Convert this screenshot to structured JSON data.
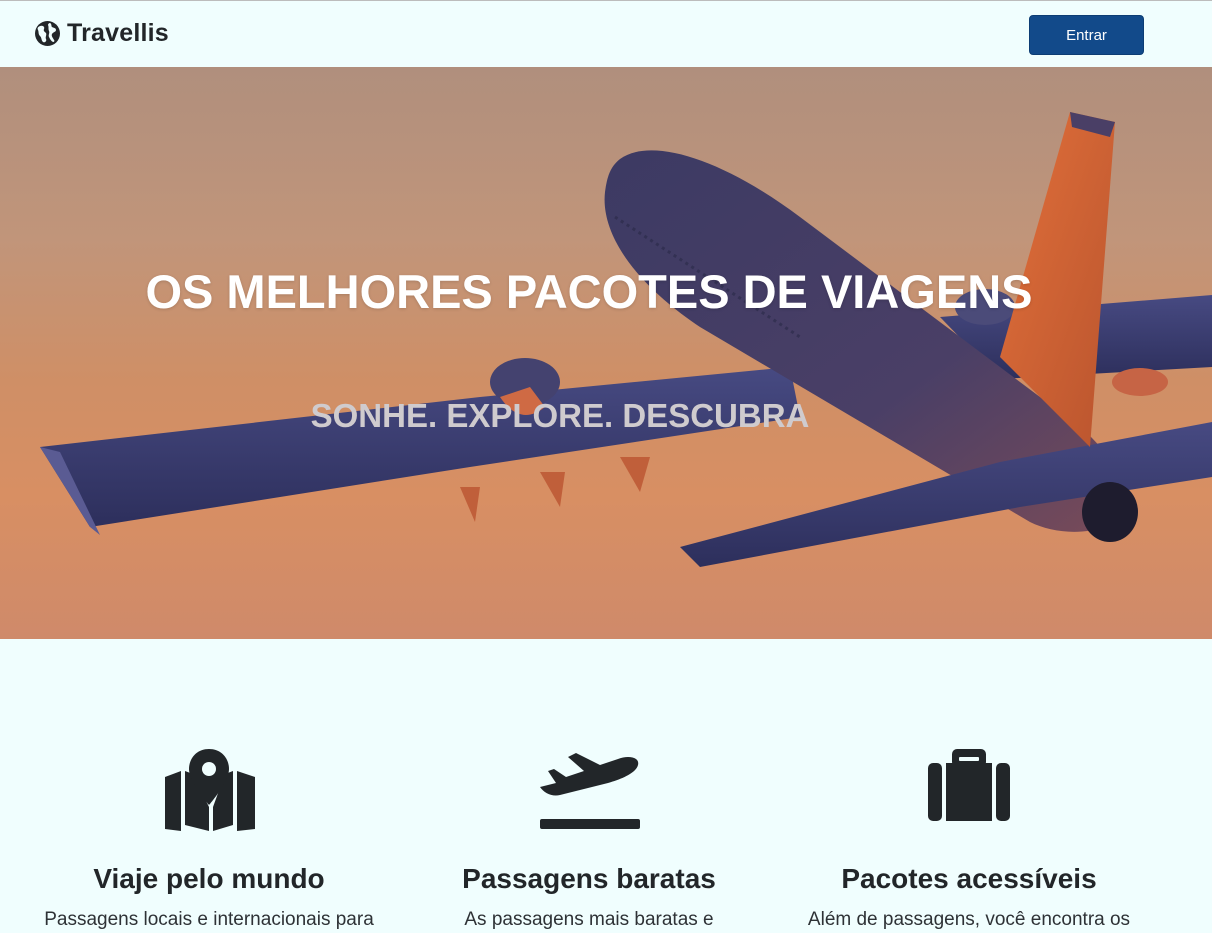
{
  "navbar": {
    "brand_icon": "globe-icon",
    "brand_name": "Travellis",
    "login_button": "Entrar"
  },
  "hero": {
    "title": "OS MELHORES PACOTES DE VIAGENS",
    "subtitle": "SONHE. EXPLORE. DESCUBRA",
    "background": "airplane-in-sunset-sky"
  },
  "features": [
    {
      "icon": "map-marker-icon",
      "title": "Viaje pelo mundo",
      "text": "Passagens locais e internacionais para"
    },
    {
      "icon": "plane-departure-icon",
      "title": "Passagens baratas",
      "text": "As passagens mais baratas e"
    },
    {
      "icon": "suitcase-icon",
      "title": "Pacotes acessíveis",
      "text": "Além de passagens, você encontra os"
    }
  ],
  "colors": {
    "page_background": "#f0fefe",
    "primary_button": "#124a8a",
    "text_dark": "#222629",
    "hero_subtitle": "#cfcbce"
  }
}
